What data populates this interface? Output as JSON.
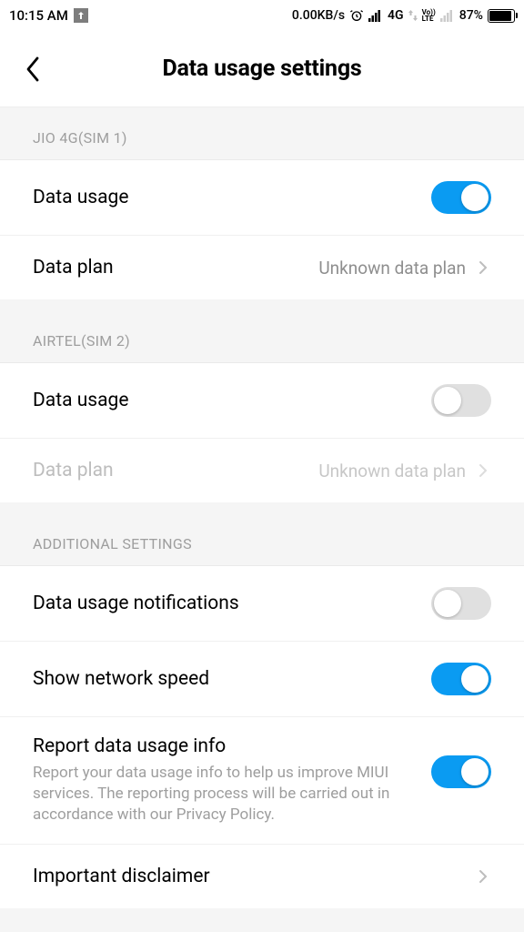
{
  "status": {
    "time": "10:15 AM",
    "speed": "0.00KB/s",
    "net1": "4G",
    "volte": "Vo))\nLTE",
    "battery": "87%"
  },
  "header": {
    "title": "Data usage settings"
  },
  "sim1": {
    "header": "JIO 4G(SIM 1)",
    "usage_label": "Data usage",
    "plan_label": "Data plan",
    "plan_value": "Unknown data plan"
  },
  "sim2": {
    "header": "AIRTEL(SIM 2)",
    "usage_label": "Data usage",
    "plan_label": "Data plan",
    "plan_value": "Unknown data plan"
  },
  "additional": {
    "header": "ADDITIONAL SETTINGS",
    "notif_label": "Data usage notifications",
    "speed_label": "Show network speed",
    "report_label": "Report data usage info",
    "report_desc": "Report your data usage info to help us improve MIUI services. The reporting process will be carried out in accordance with our Privacy Policy.",
    "disclaimer_label": "Important disclaimer"
  }
}
